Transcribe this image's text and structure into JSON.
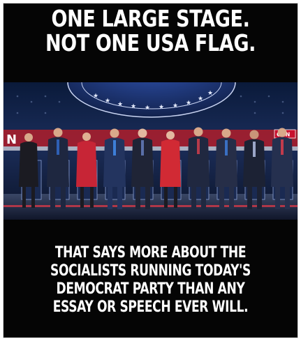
{
  "meme": {
    "top_lines": [
      "ONE LARGE STAGE.",
      "NOT ONE USA FLAG."
    ],
    "bottom_lines": [
      "THAT SAYS MORE ABOUT THE",
      "SOCIALISTS RUNNING TODAY'S",
      "DEMOCRAT PARTY THAN ANY",
      "ESSAY OR SPEECH EVER WILL."
    ],
    "photo": {
      "subject": "debate stage with ten people standing at podiums",
      "banner_fragment_left": "N",
      "banner_fragment_right": "CNN"
    }
  }
}
